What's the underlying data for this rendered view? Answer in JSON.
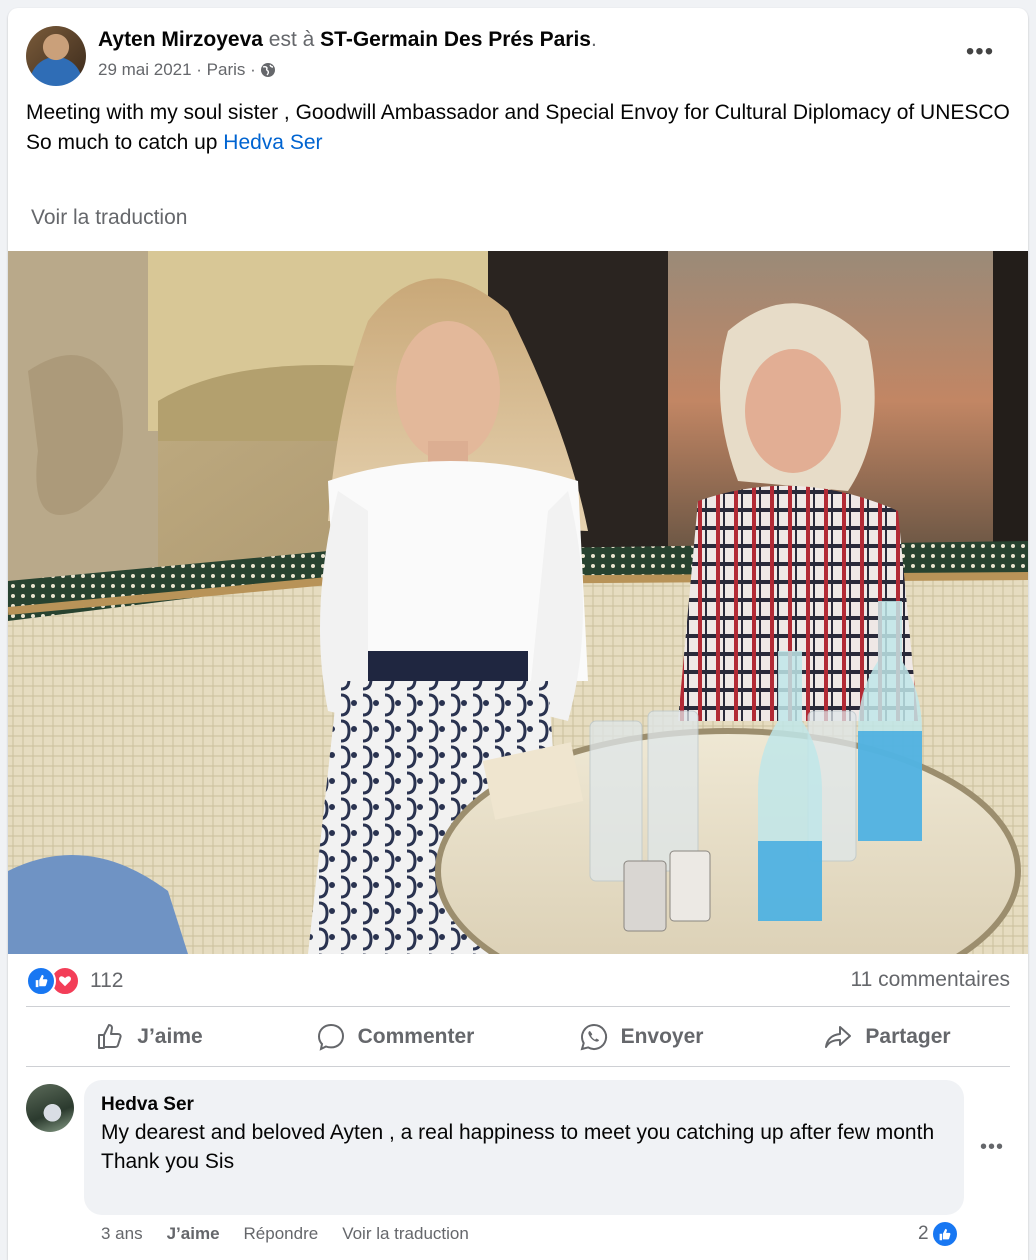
{
  "post": {
    "author": "Ayten Mirzoyeva",
    "at_word": "est à",
    "location": "ST-Germain Des Prés Paris",
    "location_suffix": ".",
    "meta": "29 mai 2021 · Paris ·",
    "privacy_icon": "globe-icon",
    "more_icon": "more-options-icon",
    "more_glyph": "•••",
    "text_line1": "Meeting with my soul sister , Goodwill Ambassador and Special Envoy for Cultural Diplomacy of UNESCO",
    "text_line2_prefix": "So much to catch up ",
    "mention": "Hedva Ser",
    "see_translation": "Voir la traduction"
  },
  "reactions": {
    "count": "112",
    "types": [
      "like-icon",
      "love-icon"
    ],
    "comments": "11 commentaires"
  },
  "actions": [
    {
      "label": "J’aime",
      "icon": "thumbs-up-icon"
    },
    {
      "label": "Commenter",
      "icon": "comment-icon"
    },
    {
      "label": "Envoyer",
      "icon": "whatsapp-icon"
    },
    {
      "label": "Partager",
      "icon": "share-icon"
    }
  ],
  "comment": {
    "author": "Hedva Ser",
    "text_line1": "My dearest and beloved Ayten , a real happiness to meet you catching up after few month",
    "text_line2": "Thank you Sis",
    "more_glyph": "•••",
    "age": "3 ans",
    "like": "J’aime",
    "reply": "Répondre",
    "translate": "Voir la traduction",
    "reaction_count": "2"
  },
  "colors": {
    "link": "#0064d1",
    "like_blue": "#1877f2",
    "love_red": "#f33e58",
    "secondary_text": "#65676b"
  }
}
